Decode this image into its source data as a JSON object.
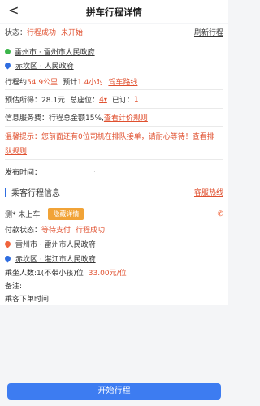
{
  "header": {
    "back": "<",
    "title": "拼车行程详情"
  },
  "status": {
    "label": "状态：",
    "state1": "行程成功",
    "state2": "未开始",
    "refresh": "刷新行程"
  },
  "trip": {
    "from": "雷州市 · 雷州市人民政府",
    "to": "赤坎区 · 人民政府",
    "distance_prefix": "行程约",
    "distance": "54.9公里",
    "eta_prefix": "预计",
    "eta": "1.4小时",
    "route_link": "驾车路线"
  },
  "earnings": {
    "expected_label": "预估所得：",
    "expected_value": "28.1元",
    "total_label": "总座位：",
    "total_value": "4",
    "booked_label": "已订：",
    "booked_value": "1"
  },
  "fee": {
    "label": "信息服务费：行程总金额15%,",
    "link": "查看计价规则"
  },
  "notice": {
    "prefix": "温馨提示：",
    "text": "您前面还有0位司机在排队接单，请耐心等待！",
    "link1": "查看排",
    "link2": "队规则"
  },
  "publish": {
    "label": "发布时间：",
    "value": "·"
  },
  "passenger": {
    "section_title": "乘客行程信息",
    "service": "客服热线",
    "name": "测* 未上车",
    "hide_btn": "隐藏详情",
    "pay_label": "付款状态：",
    "pay_status": "等待支付",
    "trip_status": "行程成功",
    "from": "雷州市 · 雷州市人民政府",
    "to": "赤坎区 · 湛江市人民政府",
    "count_label": "乘坐人数:1(不带小孩)位",
    "price": "33.00元/位",
    "remark": "备注:",
    "order_time": "乘客下单时间"
  },
  "footer": {
    "start": "开始行程"
  }
}
